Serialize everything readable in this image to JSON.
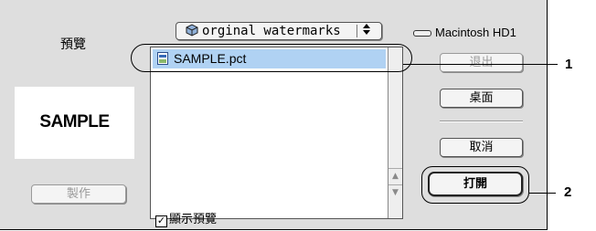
{
  "dialog": {
    "preview_label": "預覽",
    "preview_text": "SAMPLE",
    "make_button": "製作",
    "folder_popup": {
      "icon": "folder-icon",
      "label": "orginal watermarks"
    },
    "disk": {
      "icon": "hard-disk-icon",
      "label": "Macintosh HD1"
    },
    "files": [
      {
        "name": "SAMPLE.pct",
        "icon": "pict-file-icon",
        "selected": true
      }
    ],
    "show_preview": {
      "label": "顯示預覽",
      "checked": true
    },
    "buttons": {
      "eject": "退出",
      "desktop": "桌面",
      "cancel": "取消",
      "open": "打開"
    }
  },
  "callouts": {
    "one": "1",
    "two": "2"
  }
}
